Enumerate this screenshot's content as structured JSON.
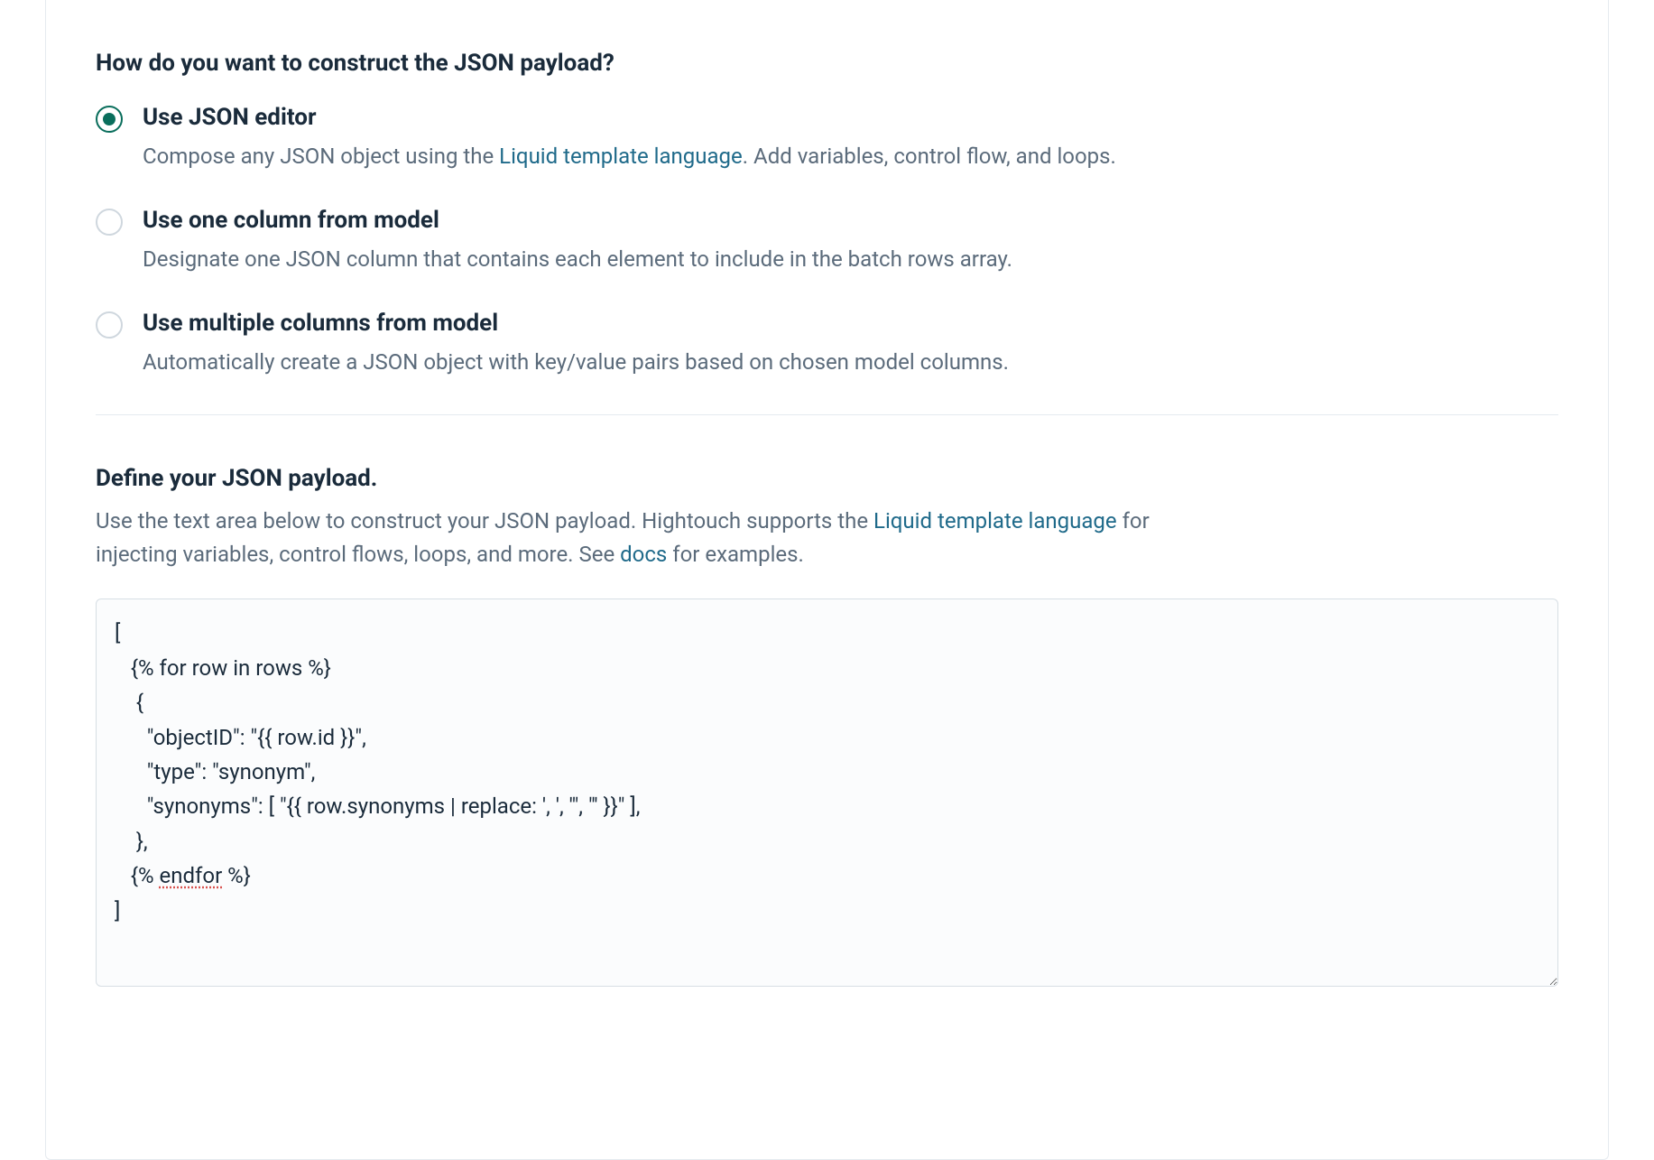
{
  "construct": {
    "heading": "How do you want to construct the JSON payload?",
    "options": [
      {
        "label": "Use JSON editor",
        "desc_pre": "Compose any JSON object using the ",
        "desc_link": "Liquid template language",
        "desc_post": ". Add variables, control flow, and loops.",
        "selected": true
      },
      {
        "label": "Use one column from model",
        "desc": "Designate one JSON column that contains each element to include in the batch rows array.",
        "selected": false
      },
      {
        "label": "Use multiple columns from model",
        "desc": "Automatically create a JSON object with key/value pairs based on chosen model columns.",
        "selected": false
      }
    ]
  },
  "define": {
    "heading": "Define your JSON payload.",
    "desc_pre": "Use the text area below to construct your JSON payload. Hightouch supports the ",
    "desc_link1": "Liquid template language",
    "desc_mid": " for injecting variables, control flows, loops, and more. See ",
    "desc_link2": "docs",
    "desc_post": " for examples.",
    "code_lines": [
      "[",
      "   {% for row in rows %}",
      "    {",
      "      \"objectID\": \"{{ row.id }}\",",
      "      \"type\": \"synonym\",",
      "      \"synonyms\": [ \"{{ row.synonyms | replace: ', ', '\", \"' }}\" ],",
      "    },",
      "   {% endfor %}",
      "]"
    ]
  }
}
